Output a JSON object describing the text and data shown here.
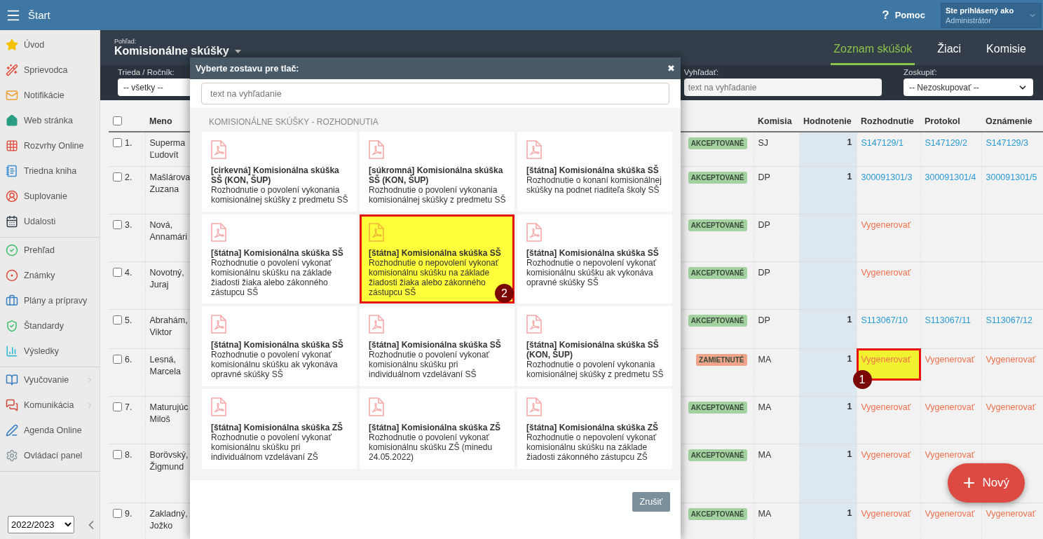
{
  "top_bar": {
    "title": "Štart",
    "help_icon": "?",
    "help": "Pomoc",
    "user_label": "Ste prihlásený ako",
    "user_name": "Administrátor"
  },
  "sidebar": {
    "groups": [
      [
        {
          "label": "Úvod",
          "expandable": false
        },
        {
          "label": "Sprievodca",
          "expandable": false
        },
        {
          "label": "Notifikácie",
          "expandable": false
        },
        {
          "label": "Web stránka",
          "expandable": false
        },
        {
          "label": "Rozvrhy Online",
          "expandable": false
        },
        {
          "label": "Triedna kniha",
          "expandable": false
        },
        {
          "label": "Suplovanie",
          "expandable": false
        },
        {
          "label": "Udalosti",
          "expandable": false
        }
      ],
      [
        {
          "label": "Prehľad",
          "expandable": false
        },
        {
          "label": "Známky",
          "expandable": false
        },
        {
          "label": "Plány a prípravy",
          "expandable": false
        },
        {
          "label": "Štandardy",
          "expandable": false
        },
        {
          "label": "Výsledky",
          "expandable": false
        }
      ],
      [
        {
          "label": "Vyučovanie",
          "expandable": true
        },
        {
          "label": "Komunikácia",
          "expandable": true
        },
        {
          "label": "Agenda Online",
          "expandable": false
        },
        {
          "label": "Ovládací panel",
          "expandable": false
        }
      ]
    ],
    "year": "2022/2023"
  },
  "header": {
    "view_label": "Pohľad:",
    "view": "Komisionálne skúšky",
    "tabs": [
      {
        "label": "Zoznam skúšok",
        "selected": true
      },
      {
        "label": "Žiaci",
        "selected": false
      },
      {
        "label": "Komisie",
        "selected": false
      }
    ],
    "filters": {
      "class_label": "Trieda / Ročník:",
      "class_value": "-- všetky --",
      "search_label": "Vyhľadať:",
      "search_placeholder": "text na vyhľadanie",
      "group_label": "Zoskupiť:",
      "group_value": "-- Nezoskupovať --"
    }
  },
  "table": {
    "all_checked": false,
    "columns": [
      "Meno",
      "Komisia",
      "Hodnotenie",
      "Rozhodnutie",
      "Protokol",
      "Oznámenie"
    ],
    "rows": [
      {
        "number": "1.",
        "checked": false,
        "surname": "Superma",
        "first_name": "Ľudovít",
        "status": "AKCEPTOVANÉ",
        "kind": "accepted",
        "commission": "SJ",
        "grade": "1",
        "documents": [
          {
            "text": "S147129/1",
            "kind": "link",
            "highlighted": false
          },
          {
            "text": "S147129/2",
            "kind": "link",
            "highlighted": false
          },
          {
            "text": "S147129/3",
            "kind": "link",
            "highlighted": false
          }
        ]
      },
      {
        "number": "2.",
        "checked": false,
        "surname": "Mašlárova",
        "first_name": "Zuzana",
        "status": "AKCEPTOVANÉ",
        "kind": "accepted",
        "commission": "DP",
        "grade": "1",
        "documents": [
          {
            "text": "300091301/3",
            "kind": "link",
            "highlighted": false
          },
          {
            "text": "300091301/4",
            "kind": "link",
            "highlighted": false
          },
          {
            "text": "300091301/5",
            "kind": "link",
            "highlighted": false
          }
        ]
      },
      {
        "number": "3.",
        "checked": false,
        "surname": "Nová,",
        "first_name": "Annamári",
        "status": "AKCEPTOVANÉ",
        "kind": "accepted",
        "commission": "DP",
        "documents": [
          {
            "text": "Vygenerovať",
            "kind": "action",
            "highlighted": false
          }
        ]
      },
      {
        "number": "4.",
        "checked": false,
        "surname": "Novotný,",
        "first_name": "Juraj",
        "status": "AKCEPTOVANÉ",
        "kind": "accepted",
        "commission": "DP",
        "documents": [
          {
            "text": "Vygenerovať",
            "kind": "action",
            "highlighted": false
          }
        ]
      },
      {
        "number": "5.",
        "checked": false,
        "surname": "Abrahám,",
        "first_name": "Viktor",
        "status": "AKCEPTOVANÉ",
        "kind": "accepted",
        "commission": "DP",
        "grade": "1",
        "documents": [
          {
            "text": "S113067/10",
            "kind": "link",
            "highlighted": false
          },
          {
            "text": "S113067/11",
            "kind": "link",
            "highlighted": false
          },
          {
            "text": "S113067/12",
            "kind": "link",
            "highlighted": false
          }
        ]
      },
      {
        "number": "6.",
        "checked": false,
        "surname": "Lesná,",
        "first_name": "Marcela",
        "status": "ZAMIETNUTÉ",
        "kind": "rejected",
        "commission": "MA",
        "grade": "1",
        "documents": [
          {
            "text": "Vygenerovať",
            "kind": "action",
            "highlighted": true,
            "marker": "1"
          },
          {
            "text": "Vygenerovať",
            "kind": "action",
            "highlighted": false
          },
          {
            "text": "Vygenerovať",
            "kind": "action",
            "highlighted": false
          }
        ]
      },
      {
        "number": "7.",
        "checked": false,
        "surname": "Maturujúc",
        "first_name": "Miloš",
        "status": "AKCEPTOVANÉ",
        "kind": "accepted",
        "commission": "MA",
        "grade": "1",
        "documents": [
          {
            "text": "Vygenerovať",
            "kind": "action",
            "highlighted": false
          },
          {
            "text": "Vygenerovať",
            "kind": "action",
            "highlighted": false
          },
          {
            "text": "Vygenerovať",
            "kind": "action",
            "highlighted": false
          }
        ]
      },
      {
        "number": "8.",
        "checked": false,
        "surname": "Borövský,",
        "first_name": "Žigmund",
        "status": "AKCEPTOVANÉ",
        "kind": "accepted",
        "commission": "MA",
        "grade": "1",
        "documents": [
          {
            "text": "Vygenerovať",
            "kind": "action",
            "highlighted": false
          },
          {
            "text": "Vygenerovať",
            "kind": "action",
            "highlighted": false
          }
        ]
      },
      {
        "number": "9.",
        "checked": false,
        "surname": "Zakladný,",
        "first_name": "Jožko",
        "status": "AKCEPTOVANÉ",
        "kind": "accepted",
        "commission": "MA",
        "grade": "1",
        "documents": [
          {
            "text": "Vygenerovať",
            "kind": "action",
            "highlighted": false
          },
          {
            "text": "Vygenerovať",
            "kind": "action",
            "highlighted": false
          },
          {
            "text": "Vygenerovať",
            "kind": "action",
            "highlighted": false
          }
        ]
      }
    ]
  },
  "fab": {
    "label": "Nový",
    "icon": "+"
  },
  "dialog": {
    "title": "Vyberte zostavu pre tlač:",
    "close": "✖",
    "search_placeholder": "text na vyhľadanie",
    "section": "KOMISIONÁLNE SKÚŠKY - ROZHODNUTIA",
    "cards": [
      {
        "title": "[cirkevná] Komisionálna skúška SŠ (KON, ŠUP)",
        "description": "Rozhodnutie o povolení vykonania komisionálnej skúšky z predmetu SŠ",
        "highlighted": false
      },
      {
        "title": "[súkromná] Komisionálna skúška SŠ (KON, ŠUP)",
        "description": "Rozhodnutie o povolení vykonania komisionálnej skúšky z predmetu SŠ",
        "highlighted": false
      },
      {
        "title": "[štátna] Komisionálna skúška SŠ",
        "description": "Rozhodnutie o konaní komisionálnej skúšky na podnet riaditeľa školy SŠ",
        "highlighted": false
      },
      {
        "title": "[štátna] Komisionálna skúška SŠ",
        "description": "Rozhodnutie o povolení vykonať komisionálnu skúšku na základe žiadosti žiaka alebo zákonného zástupcu SŠ",
        "highlighted": false
      },
      {
        "title": "[štátna] Komisionálna skúška SŠ",
        "description": "Rozhodnutie o nepovolení vykonať komisionálnu skúšku na základe žiadosti žiaka alebo zákonného zástupcu SŠ",
        "highlighted": true,
        "marker": "2"
      },
      {
        "title": "[štátna] Komisionálna skúška SŠ",
        "description": "Rozhodnutie o nepovolení vykonať komisionálnu skúšku ak vykonáva opravné skúšky SŠ",
        "highlighted": false
      },
      {
        "title": "[štátna] Komisionálna skúška SŠ",
        "description": "Rozhodnutie o povolení vykonať komisionálnu skúšku ak vykonáva opravné skúšky SŠ",
        "highlighted": false
      },
      {
        "title": "[štátna] Komisionálna skúška SŠ",
        "description": "Rozhodnutie o povolení vykonať komisionálnu skúšku pri individuálnom vzdelávaní SŠ",
        "highlighted": false
      },
      {
        "title": "[štátna] Komisionálna skúška SŠ (KON, ŠUP)",
        "description": "Rozhodnutie o povolení vykonania komisionálnej skúšky z predmetu SŠ",
        "highlighted": false
      },
      {
        "title": "[štátna] Komisionálna skúška ZŠ",
        "description": "Rozhodnutie o povolení vykonať komisionálnu skúšku pri individuálnom vzdelávaní ZŠ",
        "highlighted": false
      },
      {
        "title": "[štátna] Komisionálna skúška ZŠ",
        "description": "Rozhodnutie o povolení vykonať komisionálnu skúšku ZŠ (minedu 24.05.2022)",
        "highlighted": false
      },
      {
        "title": "[štátna] Komisionálna skúška ZŠ",
        "description": "Rozhodnutie o nepovolení vykonať komisionálnu skúšku na základe žiadosti zákonného zástupcu ZŠ",
        "highlighted": false
      }
    ],
    "cancel": "Zrušiť"
  }
}
